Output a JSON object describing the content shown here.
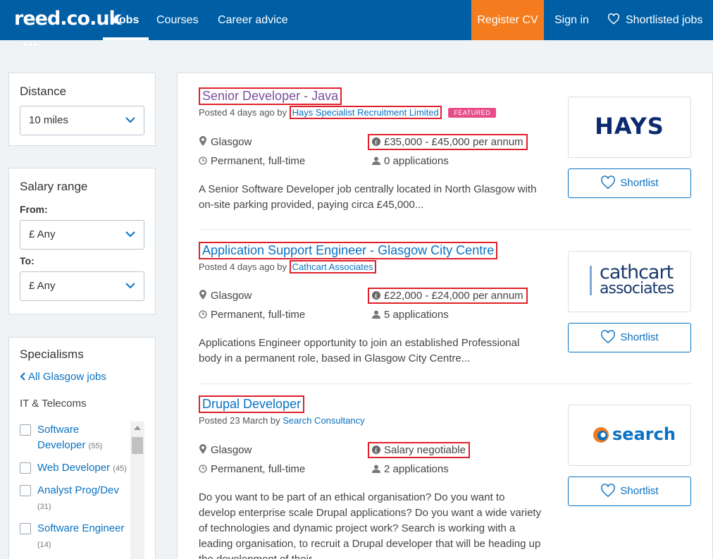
{
  "header": {
    "logo_text": "reed.co.uk",
    "nav": {
      "jobs": "Jobs",
      "courses": "Courses",
      "career_advice": "Career advice",
      "register_cv": "Register CV",
      "sign_in": "Sign in",
      "shortlisted_jobs": "Shortlisted jobs"
    },
    "colors": {
      "bar": "#005ea5",
      "register": "#f47c1f"
    }
  },
  "sidebar": {
    "distance": {
      "title": "Distance",
      "selected": "10 miles"
    },
    "salary": {
      "title": "Salary range",
      "from_label": "From:",
      "from_value": "£ Any",
      "to_label": "To:",
      "to_value": "£ Any"
    },
    "specialisms": {
      "title": "Specialisms",
      "back_link": "All Glasgow jobs",
      "category": "IT & Telecoms",
      "items": [
        {
          "label": "Software Developer",
          "count": "(55)"
        },
        {
          "label": "Web Developer",
          "count": "(45)"
        },
        {
          "label": "Analyst Prog/Dev",
          "count": "(31)"
        },
        {
          "label": "Software Engineer",
          "count": "(14)"
        }
      ]
    }
  },
  "jobs": [
    {
      "title": "Senior Developer - Java",
      "posted_prefix": "Posted 4 days ago by",
      "company": "Hays Specialist Recruitment Limited",
      "badge": "FEATURED",
      "location": "Glasgow",
      "salary": "£35,000 - £45,000 per annum",
      "type": "Permanent, full-time",
      "applications": "0 applications",
      "description": "A Senior Software Developer job centrally located in North Glasgow with on-site parking provided, paying circa £45,000...",
      "logo_text": "HAYS",
      "shortlist": "Shortlist"
    },
    {
      "title": "Application Support Engineer - Glasgow City Centre",
      "posted_prefix": "Posted 4 days ago by",
      "company": "Cathcart Associates",
      "location": "Glasgow",
      "salary": "£22,000 - £24,000 per annum",
      "type": "Permanent, full-time",
      "applications": "5 applications",
      "description": "Applications Engineer opportunity to join an established Professional body in a permanent role, based in Glasgow City Centre...",
      "logo_line1": "cathcart",
      "logo_line2": "associates",
      "shortlist": "Shortlist"
    },
    {
      "title": "Drupal Developer",
      "posted_prefix": "Posted 23 March by",
      "company": "Search Consultancy",
      "location": "Glasgow",
      "salary": "Salary negotiable",
      "type": "Permanent, full-time",
      "applications": "2 applications",
      "description": "Do you want to be part of an ethical organisation? Do you want to develop enterprise scale Drupal applications? Do you want a wide variety of technologies and dynamic project work? Search is working with a leading organisation, to recruit a Drupal developer that will be heading up the development of their...",
      "logo_text": "search",
      "shortlist": "Shortlist"
    }
  ]
}
